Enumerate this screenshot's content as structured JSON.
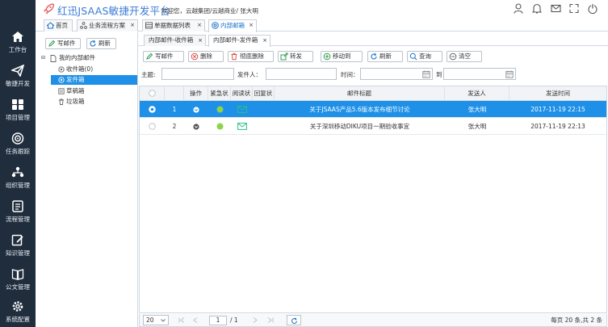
{
  "app": {
    "title": "红迅JSAAS敏捷开发平台",
    "welcome": "欢迎您，云越集团/云越商业/ 张大明"
  },
  "leftnav": [
    {
      "label": "工作台",
      "icon": "home-icon"
    },
    {
      "label": "敏捷开发",
      "icon": "paper-plane-icon"
    },
    {
      "label": "项目管理",
      "icon": "grid-icon"
    },
    {
      "label": "任务跟踪",
      "icon": "target-icon"
    },
    {
      "label": "组织管理",
      "icon": "org-icon"
    },
    {
      "label": "流程管理",
      "icon": "list-icon"
    },
    {
      "label": "知识管理",
      "icon": "edit-icon"
    },
    {
      "label": "公文管理",
      "icon": "book-icon"
    },
    {
      "label": "系统配置",
      "icon": "gear-icon"
    }
  ],
  "tabs": [
    {
      "label": "首页",
      "closable": false
    },
    {
      "label": "业务流程方案",
      "closable": true
    },
    {
      "label": "单据数据列表",
      "closable": true
    },
    {
      "label": "内部邮箱",
      "closable": true,
      "active": true
    }
  ],
  "tree": {
    "write_btn": "写邮件",
    "refresh_btn": "刷新",
    "root": "我的内部邮件",
    "items": [
      {
        "label": "收件箱(0)"
      },
      {
        "label": "发件箱",
        "selected": true
      },
      {
        "label": "草稿箱"
      },
      {
        "label": "垃圾箱"
      }
    ]
  },
  "subtabs": [
    {
      "label": "内部邮件-收件箱"
    },
    {
      "label": "内部邮件-发件箱",
      "active": true
    }
  ],
  "toolbar": {
    "write": "写邮件",
    "delete": "删除",
    "delete_all": "彻底删除",
    "forward": "转发",
    "move": "移动到",
    "refresh": "刷新",
    "query": "查询",
    "clear": "清空"
  },
  "search": {
    "subject_label": "主题:",
    "sender_label": "发件人：",
    "time_label": "时间：",
    "to_label": "到"
  },
  "grid": {
    "columns": [
      "操作",
      "紧急状",
      "阅读状",
      "回复状",
      "邮件标题",
      "发送人",
      "发送时间"
    ],
    "rows": [
      {
        "num": "1",
        "title": "关于JSAAS产品5.6版本发布细节讨论",
        "sender": "张大明",
        "time": "2017-11-19 22:15",
        "selected": true
      },
      {
        "num": "2",
        "title": "关于深圳移动DIKU项目一期验收事宜",
        "sender": "张大明",
        "time": "2017-11-19 22:13",
        "selected": false
      }
    ]
  },
  "pager": {
    "page_size": "20",
    "page": "1",
    "total_pages": "/ 1",
    "summary": "每页 20 条,共 2 条"
  },
  "colors": {
    "nav_bg": "#1f2d3d",
    "accent": "#1e90e8",
    "brand": "#3a7bd5"
  }
}
